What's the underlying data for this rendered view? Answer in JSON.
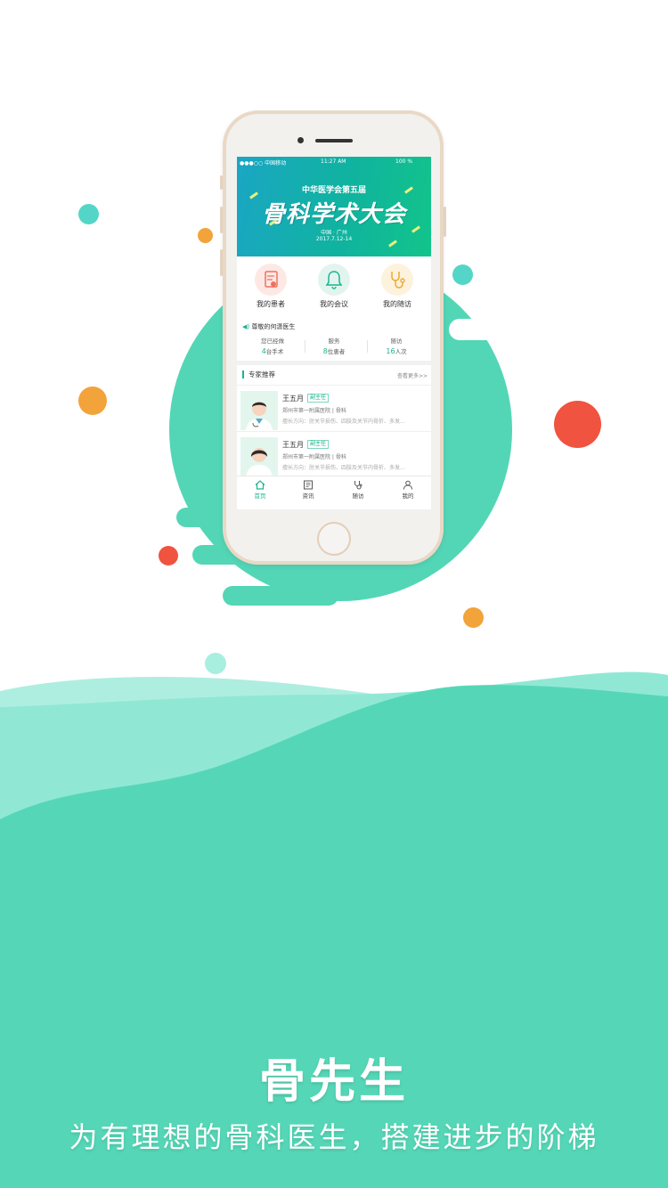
{
  "app": {
    "name": "骨先生",
    "slogan": "为有理想的骨科医生，搭建进步的阶梯"
  },
  "colors": {
    "accent": "#53d6b6",
    "orange": "#f2a33a",
    "red": "#f0533f",
    "brand_green": "#1bb38f"
  },
  "phone": {
    "status": {
      "carrier": "●●●○○ 中国移动",
      "time": "11:27 AM",
      "battery": "100 %"
    },
    "banner": {
      "subtitle": "中华医学会第五届",
      "title": "骨科学术大会",
      "location": "中国 · 广州",
      "date": "2017.7.12-14",
      "slides": 3,
      "active_slide": 1
    },
    "quick_actions": [
      {
        "label": "我的患者",
        "icon": "patient-record-icon"
      },
      {
        "label": "我的会议",
        "icon": "bell-icon"
      },
      {
        "label": "我的随访",
        "icon": "stethoscope-icon"
      }
    ],
    "greeting": "尊敬的何潇医生",
    "stats": [
      {
        "title": "您已经做",
        "value": "4",
        "unit": "台手术"
      },
      {
        "title": "服务",
        "value": "8",
        "unit": "位患者"
      },
      {
        "title": "随访",
        "value": "16",
        "unit": "人次"
      }
    ],
    "experts": {
      "title": "专家推荐",
      "more": "查看更多>>",
      "items": [
        {
          "name": "王五月",
          "tag": "副主任",
          "hospital": "郑州市第一附属医院  |  骨科",
          "specialty": "擅长方向：肘关节损伤、四肢及关节内骨折、多发..."
        },
        {
          "name": "王五月",
          "tag": "副主任",
          "hospital": "郑州市第一附属医院  |  骨科",
          "specialty": "擅长方向：肘关节损伤、四肢及关节内骨折、多发..."
        }
      ]
    },
    "tabs": [
      {
        "label": "首页",
        "icon": "home-icon",
        "active": true
      },
      {
        "label": "资讯",
        "icon": "news-icon",
        "active": false
      },
      {
        "label": "随访",
        "icon": "stethoscope-icon",
        "active": false
      },
      {
        "label": "我的",
        "icon": "user-icon",
        "active": false
      }
    ]
  }
}
